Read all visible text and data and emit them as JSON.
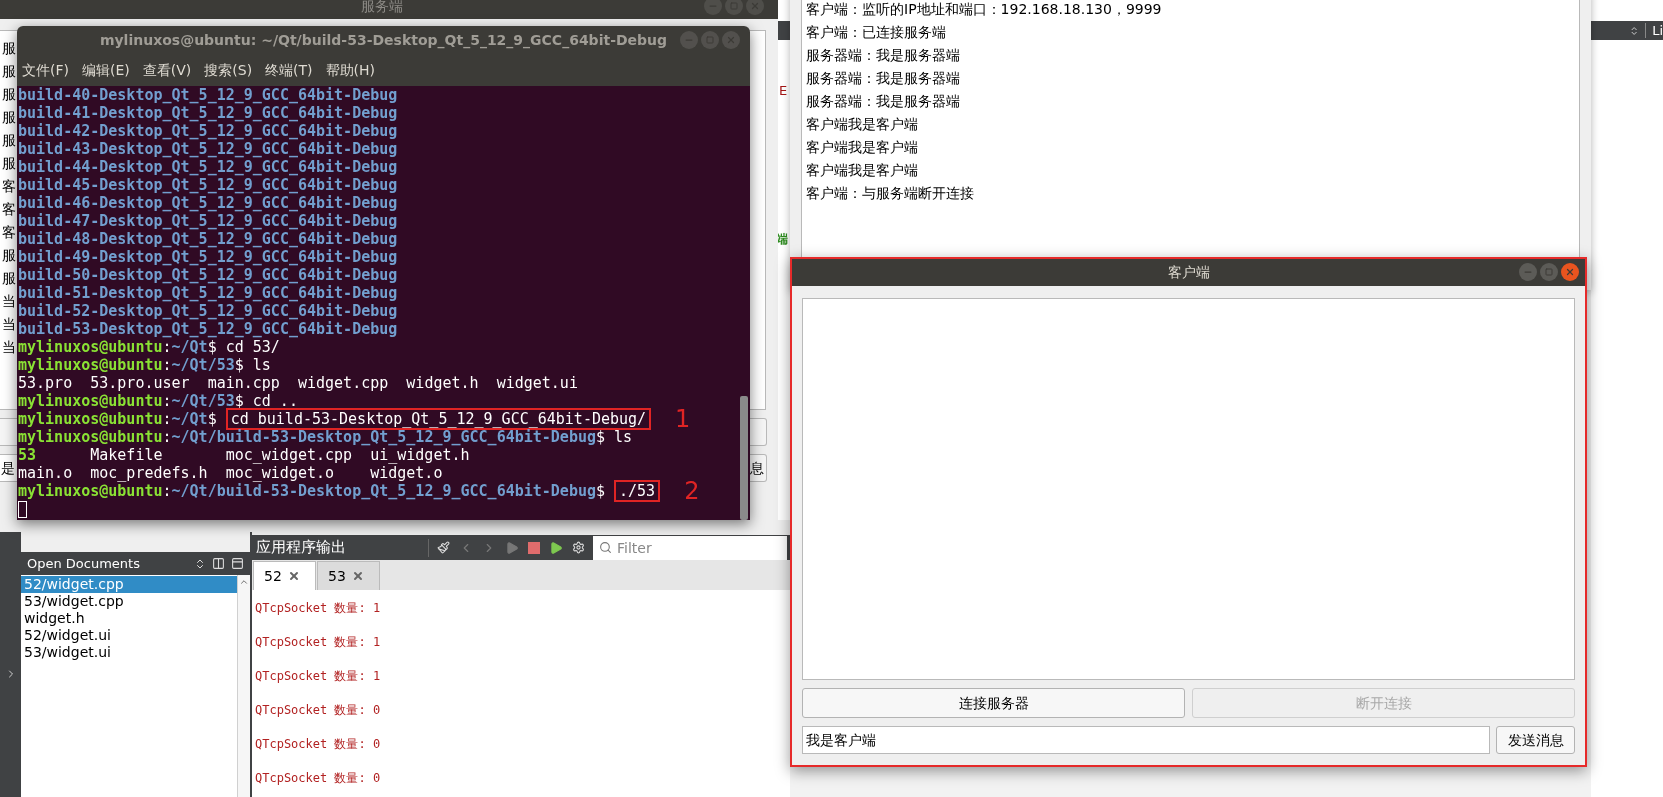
{
  "server_window": {
    "title": "服务端",
    "log_fragments": [
      "服",
      "服",
      "服",
      "服",
      "服",
      "服",
      "客",
      "客",
      "客",
      "服",
      "服",
      "当",
      "当",
      "当"
    ],
    "input_fragment": "是",
    "button_fragment": "息"
  },
  "terminal": {
    "title": "mylinuxos@ubuntu: ~/Qt/build-53-Desktop_Qt_5_12_9_GCC_64bit-Debug",
    "menu": [
      "文件(F)",
      "编辑(E)",
      "查看(V)",
      "搜索(S)",
      "终端(T)",
      "帮助(H)"
    ],
    "lines": [
      {
        "kind": "dir",
        "text": "build-40-Desktop_Qt_5_12_9_GCC_64bit-Debug"
      },
      {
        "kind": "dir",
        "text": "build-41-Desktop_Qt_5_12_9_GCC_64bit-Debug"
      },
      {
        "kind": "dir",
        "text": "build-42-Desktop_Qt_5_12_9_GCC_64bit-Debug"
      },
      {
        "kind": "dir",
        "text": "build-43-Desktop_Qt_5_12_9_GCC_64bit-Debug"
      },
      {
        "kind": "dir",
        "text": "build-44-Desktop_Qt_5_12_9_GCC_64bit-Debug"
      },
      {
        "kind": "dir",
        "text": "build-45-Desktop_Qt_5_12_9_GCC_64bit-Debug"
      },
      {
        "kind": "dir",
        "text": "build-46-Desktop_Qt_5_12_9_GCC_64bit-Debug"
      },
      {
        "kind": "dir",
        "text": "build-47-Desktop_Qt_5_12_9_GCC_64bit-Debug"
      },
      {
        "kind": "dir",
        "text": "build-48-Desktop_Qt_5_12_9_GCC_64bit-Debug"
      },
      {
        "kind": "dir",
        "text": "build-49-Desktop_Qt_5_12_9_GCC_64bit-Debug"
      },
      {
        "kind": "dir",
        "text": "build-50-Desktop_Qt_5_12_9_GCC_64bit-Debug"
      },
      {
        "kind": "dir",
        "text": "build-51-Desktop_Qt_5_12_9_GCC_64bit-Debug"
      },
      {
        "kind": "dir",
        "text": "build-52-Desktop_Qt_5_12_9_GCC_64bit-Debug"
      },
      {
        "kind": "dir",
        "text": "build-53-Desktop_Qt_5_12_9_GCC_64bit-Debug"
      },
      {
        "kind": "prompt",
        "user": "mylinuxos@ubuntu",
        "separator": ":",
        "path": "~/Qt",
        "sign": "$",
        "command": "cd 53/"
      },
      {
        "kind": "prompt",
        "user": "mylinuxos@ubuntu",
        "separator": ":",
        "path": "~/Qt/53",
        "sign": "$",
        "command": "ls"
      },
      {
        "kind": "output",
        "text": "53.pro  53.pro.user  main.cpp  widget.cpp  widget.h  widget.ui"
      },
      {
        "kind": "prompt",
        "user": "mylinuxos@ubuntu",
        "separator": ":",
        "path": "~/Qt/53",
        "sign": "$",
        "command": "cd .."
      },
      {
        "kind": "prompt",
        "user": "mylinuxos@ubuntu",
        "separator": ":",
        "path": "~/Qt",
        "sign": "$",
        "command": "cd build-53-Desktop_Qt_5_12_9_GCC_64bit-Debug/",
        "annotation": "1"
      },
      {
        "kind": "prompt",
        "user": "mylinuxos@ubuntu",
        "separator": ":",
        "path": "~/Qt/build-53-Desktop_Qt_5_12_9_GCC_64bit-Debug",
        "sign": "$",
        "command": "ls"
      },
      {
        "kind": "listing",
        "cells": [
          {
            "text": "53",
            "executable": true
          },
          {
            "text": "Makefile",
            "executable": false
          },
          {
            "text": "moc_widget.cpp",
            "executable": false
          },
          {
            "text": "ui_widget.h",
            "executable": false
          }
        ]
      },
      {
        "kind": "listing",
        "cells": [
          {
            "text": "main.o",
            "executable": false
          },
          {
            "text": "moc_predefs.h",
            "executable": false
          },
          {
            "text": "moc_widget.o",
            "executable": false
          },
          {
            "text": "widget.o",
            "executable": false
          }
        ]
      },
      {
        "kind": "prompt",
        "user": "mylinuxos@ubuntu",
        "separator": ":",
        "path": "~/Qt/build-53-Desktop_Qt_5_12_9_GCC_64bit-Debug",
        "sign": "$",
        "command": "./53",
        "annotation": "2"
      },
      {
        "kind": "cursor"
      }
    ]
  },
  "editor_fragments": [
    {
      "text": "E",
      "color": "#a31515"
    },
    {
      "text": "端",
      "color": "#2e8b20"
    }
  ],
  "top_right": {
    "label": "Li"
  },
  "client_log_window": {
    "lines": [
      "客户端：监听的IP地址和端口：192.168.18.130，9999",
      "客户端：已连接服务端",
      "服务器端：我是服务器端",
      "服务器端：我是服务器端",
      "服务器端：我是服务器端",
      "客户端我是客户端",
      "客户端我是客户端",
      "客户端我是客户端",
      "客户端：与服务端断开连接"
    ]
  },
  "qt_creator": {
    "open_documents": {
      "title": "Open Documents",
      "items": [
        {
          "label": "52/widget.cpp",
          "selected": true
        },
        {
          "label": "53/widget.cpp",
          "selected": false
        },
        {
          "label": "widget.h",
          "selected": false
        },
        {
          "label": "52/widget.ui",
          "selected": false
        },
        {
          "label": "53/widget.ui",
          "selected": false
        }
      ]
    },
    "output": {
      "title": "应用程序输出",
      "filter_placeholder": "Filter",
      "tabs": [
        {
          "label": "52",
          "selected": true
        },
        {
          "label": "53",
          "selected": false
        }
      ],
      "lines": [
        "QTcpSocket 数量: 1",
        "QTcpSocket 数量: 1",
        "QTcpSocket 数量: 1",
        "QTcpSocket 数量: 0",
        "QTcpSocket 数量: 0",
        "QTcpSocket 数量: 0"
      ]
    }
  },
  "client_window": {
    "title": "客户端",
    "buttons": [
      {
        "label": "连接服务器",
        "disabled": false
      },
      {
        "label": "断开连接",
        "disabled": true
      }
    ],
    "message_input": {
      "value": "我是客户端"
    },
    "send_button": "发送消息"
  }
}
